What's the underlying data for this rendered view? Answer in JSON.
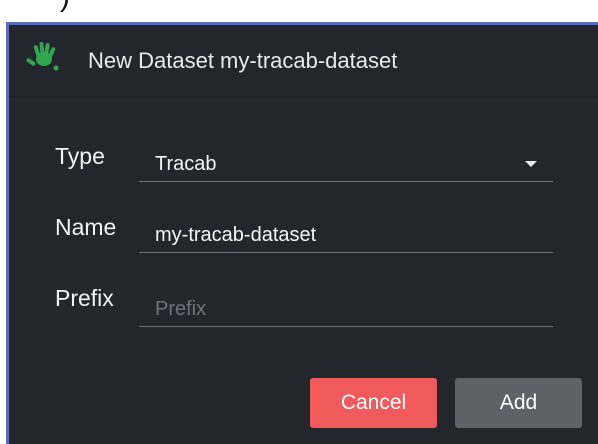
{
  "dialog": {
    "title": "New Dataset my-tracab-dataset",
    "logo_icon": "green-hand-icon",
    "accent_color": "#5b6bb5",
    "background_color": "#23272d"
  },
  "form": {
    "type": {
      "label": "Type",
      "value": "Tracab"
    },
    "name": {
      "label": "Name",
      "value": "my-tracab-dataset"
    },
    "prefix": {
      "label": "Prefix",
      "placeholder": "Prefix",
      "value": ""
    }
  },
  "actions": {
    "cancel_label": "Cancel",
    "cancel_color": "#f05a5a",
    "add_label": "Add",
    "add_color": "#5d6168"
  }
}
